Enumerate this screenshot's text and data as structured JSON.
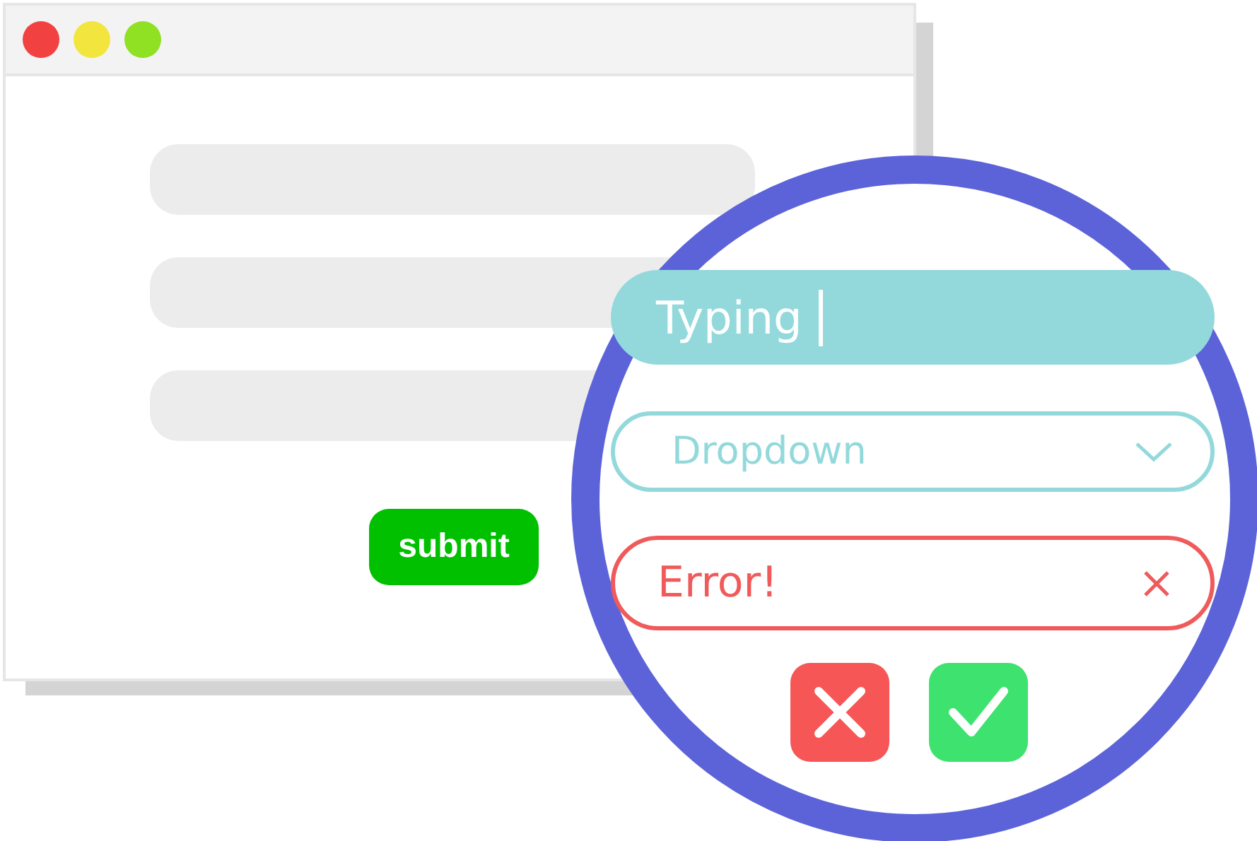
{
  "window": {
    "dots": [
      {
        "color": "#f24141"
      },
      {
        "color": "#f2e53d"
      },
      {
        "color": "#90e024"
      }
    ],
    "submit_button": {
      "label": "submit"
    }
  },
  "zoom": {
    "text_field": {
      "value": "Typing"
    },
    "dropdown": {
      "placeholder": "Dropdown"
    },
    "error_field": {
      "value": "Error!",
      "error": true
    },
    "buttons": [
      {
        "kind": "cancel"
      },
      {
        "kind": "confirm"
      }
    ]
  }
}
